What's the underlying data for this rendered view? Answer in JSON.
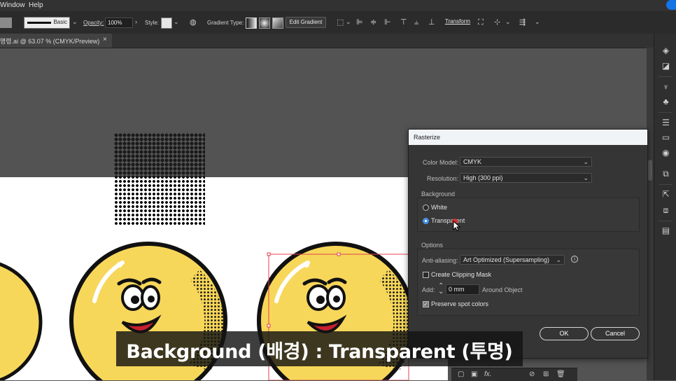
{
  "menubar": {
    "items": [
      "Window",
      "Help"
    ]
  },
  "control_bar": {
    "stroke_style": "Basic",
    "opacity_label": "Opacity:",
    "opacity_value": "100%",
    "style_label": "Style:",
    "gradient_type_label": "Gradient Type:",
    "edit_gradient_label": "Edit Gradient",
    "transform_label": "Transform"
  },
  "document_tab": {
    "title": "명령.ai @ 63.07 % (CMYK/Preview)",
    "close": "×"
  },
  "dialog": {
    "title": "Rasterize",
    "color_model_label": "Color Model:",
    "color_model_value": "CMYK",
    "resolution_label": "Resolution:",
    "resolution_value": "High (300 ppi)",
    "background_section": "Background",
    "background_white": "White",
    "background_transparent": "Transparent",
    "options_section": "Options",
    "anti_aliasing_label": "Anti-aliasing:",
    "anti_aliasing_value": "Art Optimized (Supersampling)",
    "create_clipping_mask": "Create Clipping Mask",
    "add_label": "Add:",
    "add_value": "0 mm",
    "around_object": "Around Object",
    "preserve_spot_colors": "Preserve spot colors",
    "ok": "OK",
    "cancel": "Cancel"
  },
  "caption": "Background (배경) : Transparent (투명)",
  "colors": {
    "accent": "#1473e6",
    "artboard": "#ffffff",
    "pasteboard": "#535353",
    "smiley_fill": "#f7d75a"
  }
}
